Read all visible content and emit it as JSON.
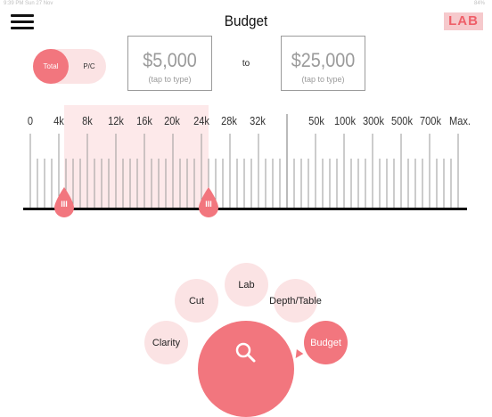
{
  "status_bar": {
    "left": "9:39 PM  Sun 27 Nov",
    "right": "84%"
  },
  "header": {
    "title": "Budget",
    "logo_text": "LAB"
  },
  "toggle": {
    "total_label": "Total",
    "pc_label": "P/C",
    "selected": "Total"
  },
  "price_range": {
    "min_value": "$5,000",
    "min_hint": "(tap to type)",
    "to_label": "to",
    "max_value": "$25,000",
    "max_hint": "(tap to type)"
  },
  "slider": {
    "tick_labels": [
      "0",
      "4k",
      "8k",
      "12k",
      "16k",
      "20k",
      "24k",
      "28k",
      "32k",
      "50k",
      "100k",
      "300k",
      "500k",
      "700k",
      "Max."
    ],
    "left_handle_label": "III",
    "right_handle_label": "III"
  },
  "nav": {
    "clarity": "Clarity",
    "cut": "Cut",
    "lab": "Lab",
    "depth_table": "Depth/Table",
    "budget": "Budget"
  },
  "colors": {
    "accent": "#f2767e",
    "accent_light": "#fbe3e4"
  }
}
